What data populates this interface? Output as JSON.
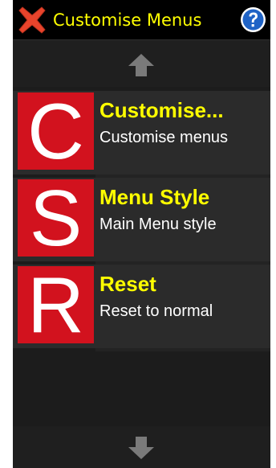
{
  "header": {
    "title": "Customise Menus",
    "close_icon": "close-x-icon",
    "help_icon": "help-question-icon"
  },
  "scroll": {
    "up_icon": "arrow-up-icon",
    "down_icon": "arrow-down-icon"
  },
  "menu": {
    "items": [
      {
        "letter": "C",
        "title": "Customise...",
        "subtitle": "Customise menus"
      },
      {
        "letter": "S",
        "title": "Menu Style",
        "subtitle": "Main Menu style"
      },
      {
        "letter": "R",
        "title": "Reset",
        "subtitle": "Reset to normal"
      }
    ]
  },
  "colors": {
    "title_yellow": "#ffff00",
    "tile_red": "#d2121e",
    "close_red": "#e8442c",
    "help_blue": "#1f63c6",
    "arrow_gray": "#7a7a7a",
    "background": "#1c1c1c"
  }
}
